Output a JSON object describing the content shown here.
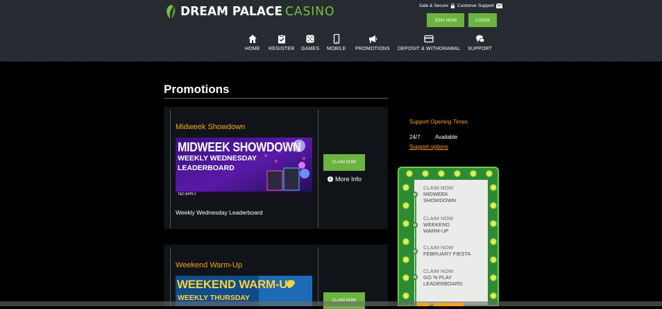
{
  "header": {
    "logo_main": "DREAM PALACE",
    "logo_accent": "CASINO",
    "safe_label": "Safe & Secure",
    "support_label": "Customer Support",
    "join_label": "JOIN NOW",
    "login_label": "LOGIN",
    "nav": [
      {
        "label": "HOME",
        "icon": "home-icon"
      },
      {
        "label": "REGISTER",
        "icon": "clipboard-check-icon"
      },
      {
        "label": "GAMES",
        "icon": "dice-icon"
      },
      {
        "label": "MOBILE",
        "icon": "mobile-icon"
      },
      {
        "label": "PROMOTIONS",
        "icon": "megaphone-icon"
      },
      {
        "label": "DEPOSIT & WITHDRAWAL",
        "icon": "credit-card-icon"
      },
      {
        "label": "SUPPORT",
        "icon": "chat-bubbles-icon"
      }
    ]
  },
  "main": {
    "title": "Promotions",
    "promos": [
      {
        "title": "Midweek Showdown",
        "banner_line1": "MIDWEEK SHOWDOWN",
        "banner_line2": "WEEKLY WEDNESDAY",
        "banner_line3": "LEADERBOARD",
        "banner_tc": "T&C APPLY",
        "description": "Weekly Wednesday Leaderboard",
        "claim_label": "CLAIM NOW",
        "more_label": "More Info"
      },
      {
        "title": "Weekend Warm-Up",
        "banner_line1": "WEEKEND WARM-UP",
        "banner_line2": "WEEKLY THURSDAY",
        "claim_label": "CLAIM NOW"
      }
    ]
  },
  "sidebar": {
    "support_title": "Support Opening Times",
    "hours": "24/7",
    "availability": "Available",
    "link": "Support options",
    "ticker": [
      {
        "claim": "CLAIM NOW",
        "name_line1": "MIDWEEK",
        "name_line2": "SHOWDOWN"
      },
      {
        "claim": "CLAIM NOW",
        "name_line1": "WEEKEND",
        "name_line2": "WARM-UP"
      },
      {
        "claim": "CLAIM NOW",
        "name_line1": "FEBRUARY FIESTA",
        "name_line2": ""
      },
      {
        "claim": "CLAIM NOW",
        "name_line1": "GO 'N PLAY",
        "name_line2": "LEADERBOARD"
      }
    ]
  },
  "colors": {
    "accent_green": "#6cb33f",
    "promo_orange": "#f5a51c",
    "marquee_green": "#2d8a32"
  }
}
